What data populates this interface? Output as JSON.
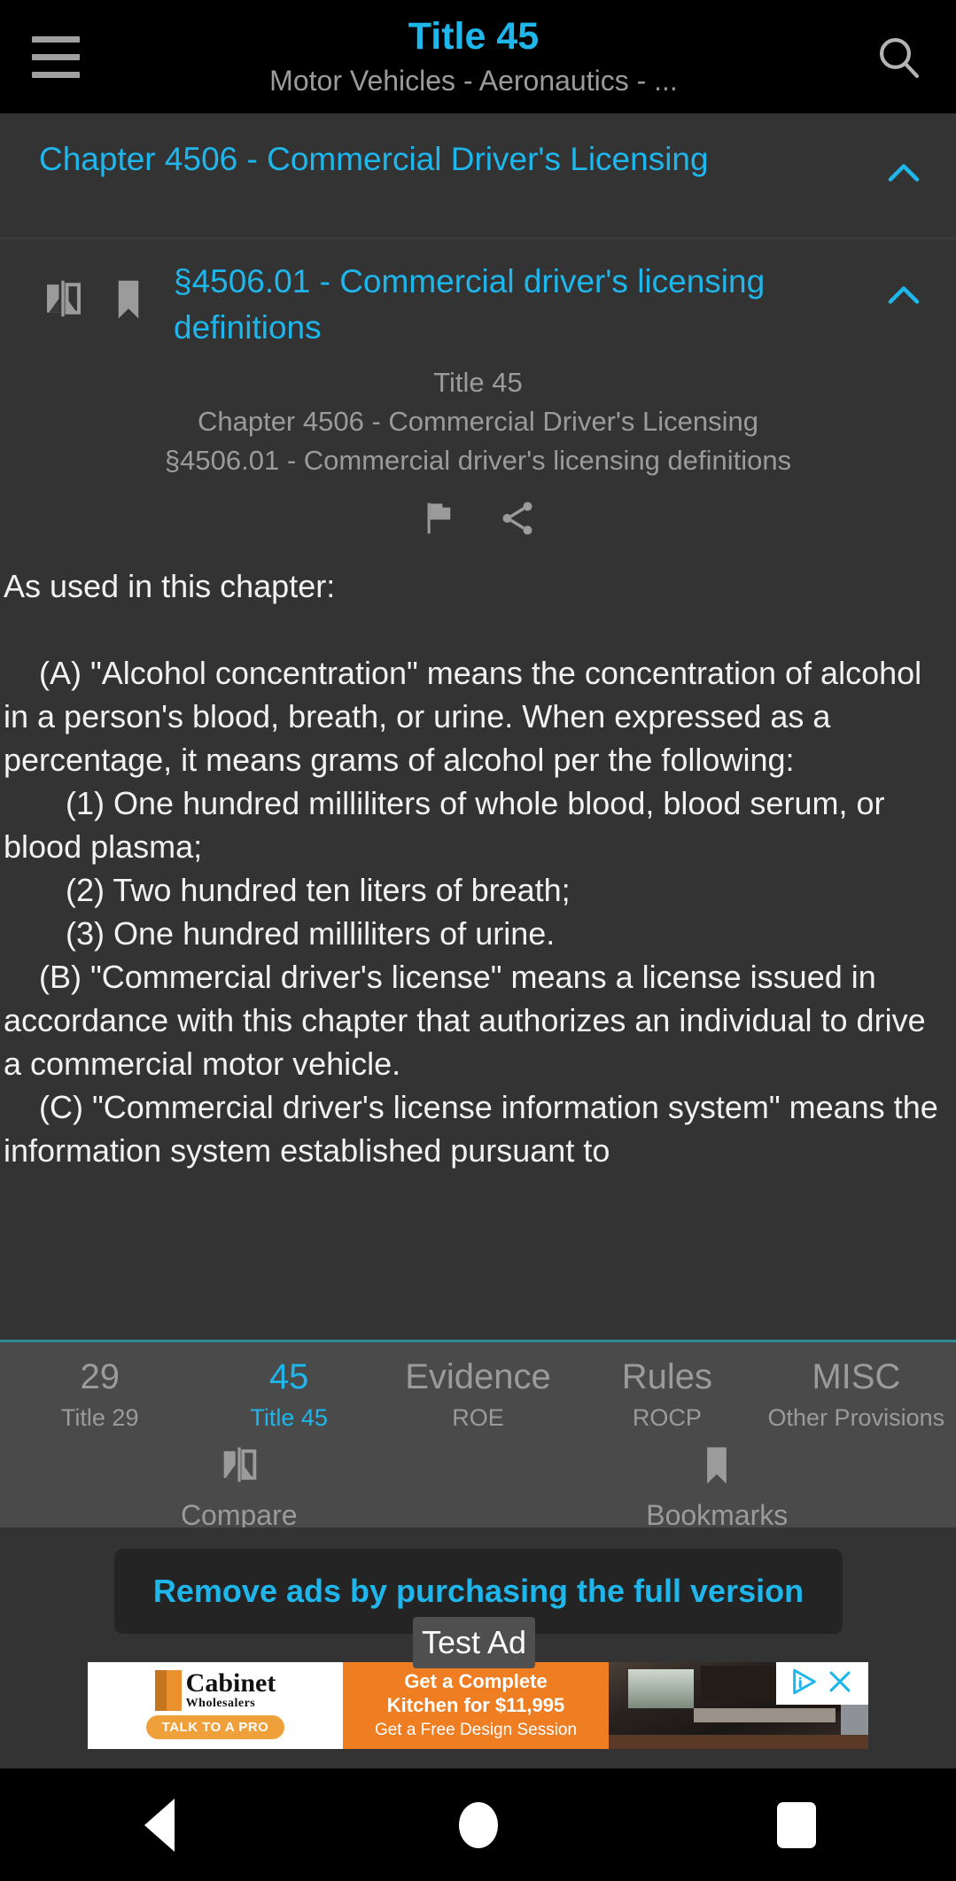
{
  "appbar": {
    "menu_icon": "hamburger-menu-icon",
    "title": "Title 45",
    "subtitle": "Motor Vehicles - Aeronautics - ...",
    "search_icon": "search-icon"
  },
  "chapter": {
    "title": "Chapter 4506 - Commercial Driver's Licensing",
    "collapse_icon": "chevron-up-icon"
  },
  "section": {
    "compare_icon": "compare-icon",
    "bookmark_icon": "bookmark-icon",
    "title": "§4506.01 - Commercial driver's licensing definitions",
    "collapse_icon": "chevron-up-icon",
    "breadcrumb": [
      "Title 45",
      "Chapter 4506 - Commercial Driver's Licensing",
      "§4506.01 - Commercial driver's licensing definitions"
    ],
    "flag_icon": "flag-icon",
    "share_icon": "share-icon"
  },
  "body": {
    "text": "As used in this chapter:\n\n    (A) \"Alcohol concentration\" means the concentration of alcohol in a person's blood, breath, or urine. When expressed as a percentage, it means grams of alcohol per the following:\n       (1) One hundred milliliters of whole blood, blood serum, or blood plasma;\n       (2) Two hundred ten liters of breath;\n       (3) One hundred milliliters of urine.\n    (B) \"Commercial driver's license\" means a license issued in accordance with this chapter that authorizes an individual to drive a commercial motor vehicle.\n    (C) \"Commercial driver's license information system\" means the information system established pursuant to"
  },
  "tabbar": {
    "tabs": [
      {
        "top": "29",
        "bottom": "Title 29",
        "active": false
      },
      {
        "top": "45",
        "bottom": "Title 45",
        "active": true
      },
      {
        "top": "Evidence",
        "bottom": "ROE",
        "active": false
      },
      {
        "top": "Rules",
        "bottom": "ROCP",
        "active": false
      },
      {
        "top": "MISC",
        "bottom": "Other Provisions",
        "active": false
      }
    ],
    "tools": [
      {
        "icon": "compare-icon",
        "label": "Compare"
      },
      {
        "icon": "bookmark-icon",
        "label": "Bookmarks"
      }
    ]
  },
  "ads": {
    "remove_ads_label": "Remove ads by purchasing the full version",
    "test_ad_label": "Test Ad",
    "banner": {
      "brand_name": "Cabinet",
      "brand_sub": "Wholesalers",
      "cta_button": "TALK TO A PRO",
      "line1": "Get a Complete",
      "line2": "Kitchen for $11,995",
      "line3": "Get a Free Design Session",
      "adchoices_icon": "adchoices-icon",
      "close_icon": "close-icon"
    }
  },
  "navbar": {
    "back_icon": "back-triangle-icon",
    "home_icon": "home-circle-icon",
    "recents_icon": "recents-square-icon"
  },
  "colors": {
    "accent": "#1fb6ec",
    "content_bg": "#333333",
    "tabbar_bg": "#4a4a4a",
    "appbar_bg": "#000000",
    "muted_text": "#9b9b9b",
    "body_text": "#f2f2f2",
    "teal_rule": "#2e8a95",
    "ad_orange": "#ef7d22"
  }
}
